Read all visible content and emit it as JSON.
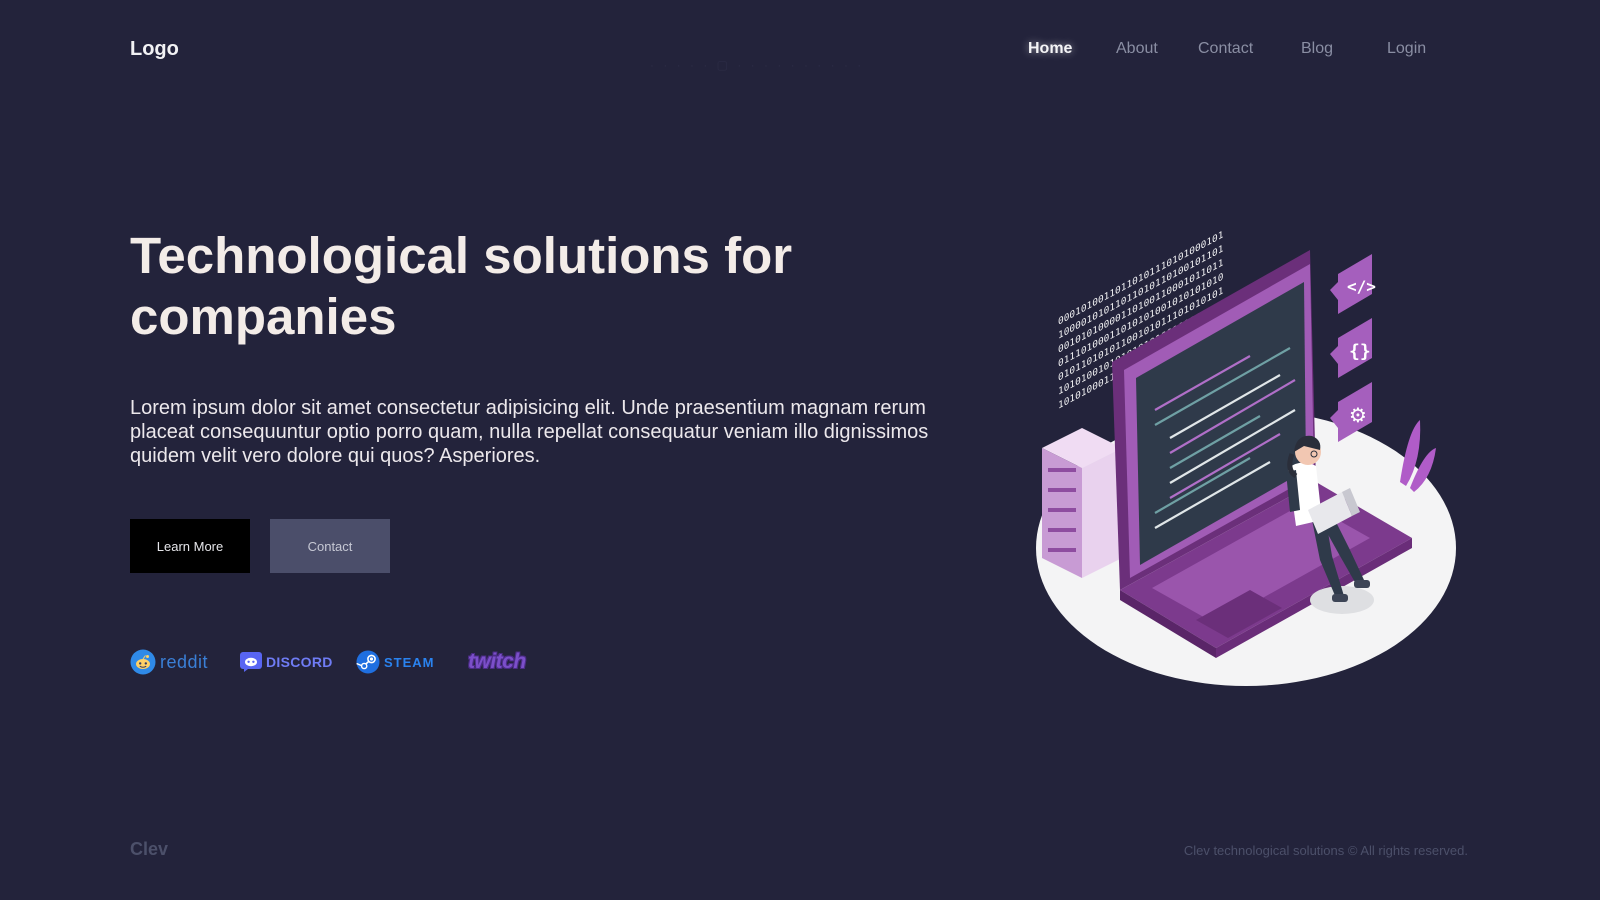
{
  "header": {
    "logo": "Logo",
    "nav": [
      {
        "label": "Home",
        "active": true
      },
      {
        "label": "About",
        "active": false
      },
      {
        "label": "Contact",
        "active": false
      },
      {
        "label": "Blog",
        "active": false
      },
      {
        "label": "Login",
        "active": false
      }
    ]
  },
  "hero": {
    "title": "Technological solutions for companies",
    "description": "Lorem ipsum dolor sit amet consectetur adipisicing elit. Unde praesentium magnam rerum placeat consequuntur optio porro quam, nulla repellat consequatur veniam illo dignissimos quidem velit vero dolore qui quos? Asperiores.",
    "buttons": {
      "learn_more": "Learn More",
      "contact": "Contact"
    }
  },
  "partners": [
    {
      "name": "reddit",
      "icon": "reddit-icon",
      "color": "#2f7bd8"
    },
    {
      "name": "DISCORD",
      "icon": "discord-icon",
      "color": "#5865f2"
    },
    {
      "name": "STEAM",
      "icon": "steam-icon",
      "color": "#1f6fe0"
    },
    {
      "name": "twitch",
      "icon": "twitch-icon",
      "color": "#6441a5"
    }
  ],
  "illustration": {
    "binary_rows": [
      "00010100110110101110101000101",
      "10000101011011010110100101101",
      "00101010000110100110001011011",
      "01110100011010101001010101010",
      "01011010101100101011101010101",
      "10101001010101010100101010101",
      "10101000110101010101001010101"
    ]
  },
  "footer": {
    "brand": "Clev",
    "copyright": "Clev technological solutions © All rights reserved."
  },
  "colors": {
    "background": "#23233b",
    "accent_purple": "#8e4ca0",
    "title": "#f3ece8"
  }
}
